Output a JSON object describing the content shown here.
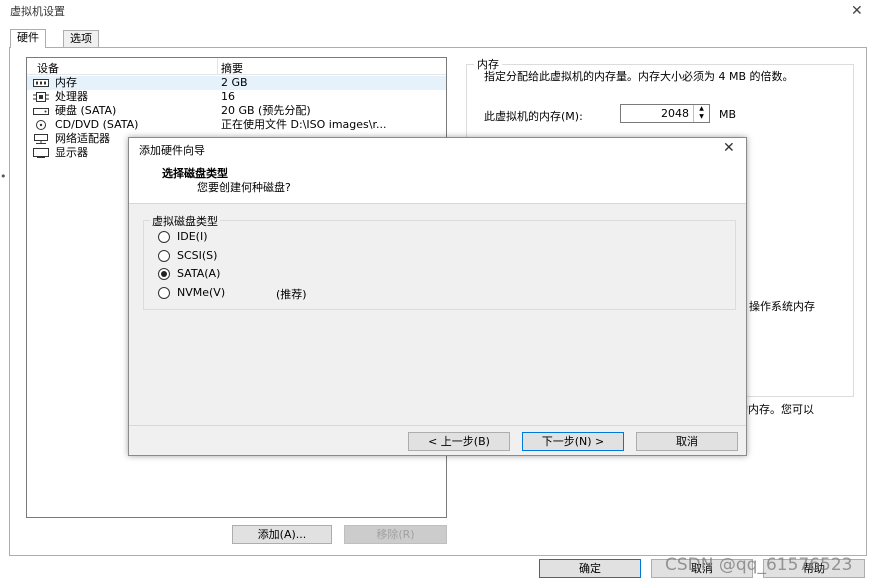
{
  "window": {
    "title": "虚拟机设置"
  },
  "tabs": [
    {
      "label": "硬件"
    },
    {
      "label": "选项"
    }
  ],
  "device_list": {
    "headers": {
      "device": "设备",
      "summary": "摘要"
    },
    "rows": [
      {
        "name": "内存",
        "summary": "2 GB",
        "icon": "memory-icon"
      },
      {
        "name": "处理器",
        "summary": "16",
        "icon": "cpu-icon"
      },
      {
        "name": "硬盘 (SATA)",
        "summary": "20 GB (预先分配)",
        "icon": "disk-icon"
      },
      {
        "name": "CD/DVD (SATA)",
        "summary": "正在使用文件 D:\\ISO images\\r...",
        "icon": "cd-icon"
      },
      {
        "name": "网络适配器",
        "summary": "",
        "icon": "network-icon"
      },
      {
        "name": "显示器",
        "summary": "",
        "icon": "display-icon"
      }
    ]
  },
  "buttons": {
    "add": "添加(A)...",
    "remove": "移除(R)",
    "ok": "确定",
    "cancel": "取消",
    "help": "帮助"
  },
  "memory": {
    "group_title": "内存",
    "description": "指定分配给此虚拟机的内存量。内存大小必须为 4 MB 的倍数。",
    "label": "此虚拟机的内存(M):",
    "value": "2048",
    "unit": "MB",
    "fragment_1": "操作系统内存",
    "fragment_2": "的内存。您可以"
  },
  "dialog": {
    "title": "添加硬件向导",
    "heading": "选择磁盘类型",
    "subheading": "您要创建何种磁盘?",
    "group_title": "虚拟磁盘类型",
    "options": [
      {
        "label": "IDE(I)",
        "selected": false,
        "extra": ""
      },
      {
        "label": "SCSI(S)",
        "selected": false,
        "extra": ""
      },
      {
        "label": "SATA(A)",
        "selected": true,
        "extra": ""
      },
      {
        "label": "NVMe(V)",
        "selected": false,
        "extra": "(推荐)"
      }
    ],
    "buttons": {
      "back": "< 上一步(B)",
      "next": "下一步(N) >",
      "cancel": "取消"
    }
  },
  "watermark": "CSDN @qq_61576523"
}
